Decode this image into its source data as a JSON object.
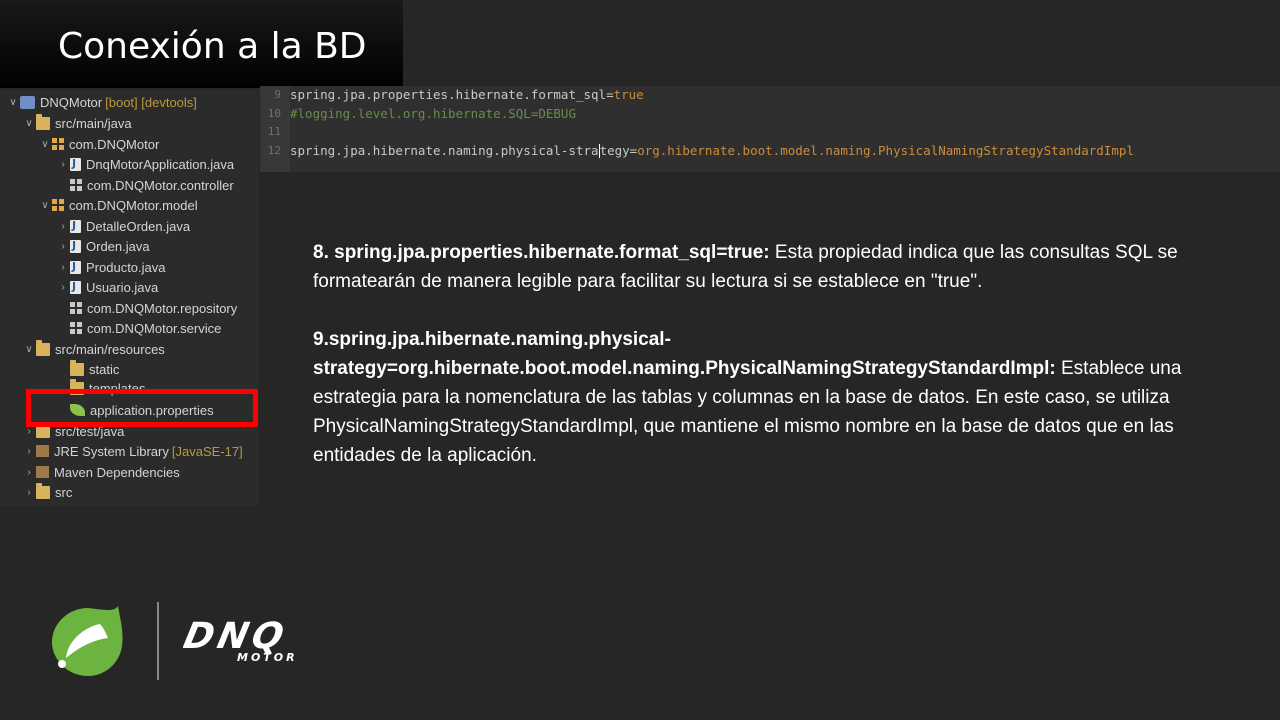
{
  "slide": {
    "title": "Conexión a la BD"
  },
  "explorer": {
    "rows": [
      {
        "twisty": "v",
        "icon": "proj",
        "label": "DNQMotor",
        "extra": "[boot] [devtools]"
      },
      {
        "twisty": "v",
        "icon": "folder",
        "label": "src/main/java"
      },
      {
        "twisty": "v",
        "icon": "pkg",
        "label": "com.DNQMotor"
      },
      {
        "twisty": ">",
        "icon": "java",
        "label": "DnqMotorApplication.java"
      },
      {
        "twisty": "",
        "icon": "pkg-empty",
        "label": "com.DNQMotor.controller"
      },
      {
        "twisty": "v",
        "icon": "pkg",
        "label": "com.DNQMotor.model"
      },
      {
        "twisty": ">",
        "icon": "java",
        "label": "DetalleOrden.java"
      },
      {
        "twisty": ">",
        "icon": "java",
        "label": "Orden.java"
      },
      {
        "twisty": ">",
        "icon": "java",
        "label": "Producto.java"
      },
      {
        "twisty": ">",
        "icon": "java",
        "label": "Usuario.java"
      },
      {
        "twisty": "",
        "icon": "pkg-empty",
        "label": "com.DNQMotor.repository"
      },
      {
        "twisty": "",
        "icon": "pkg-empty",
        "label": "com.DNQMotor.service"
      },
      {
        "twisty": "v",
        "icon": "folder",
        "label": "src/main/resources"
      },
      {
        "twisty": "",
        "icon": "folder",
        "label": "static"
      },
      {
        "twisty": "",
        "icon": "folder",
        "label": "templates"
      },
      {
        "twisty": "",
        "icon": "leaf",
        "label": "application.properties"
      },
      {
        "twisty": ">",
        "icon": "folder",
        "label": "src/test/java"
      },
      {
        "twisty": ">",
        "icon": "jar",
        "label": "JRE System Library",
        "extra": "[JavaSE-17]"
      },
      {
        "twisty": ">",
        "icon": "jar",
        "label": "Maven Dependencies"
      },
      {
        "twisty": ">",
        "icon": "folder",
        "label": "src"
      }
    ]
  },
  "editor": {
    "lines": [
      {
        "num": "9",
        "key": "spring.jpa.properties.hibernate.format_sql=",
        "value": "true"
      },
      {
        "num": "10",
        "comment": "#logging.level.org.hibernate.SQL=DEBUG"
      },
      {
        "num": "11"
      },
      {
        "num": "12",
        "key_before_caret": "spring.jpa.hibernate.naming.physical-stra",
        "key_after_caret": "tegy=",
        "value": "org.hibernate.boot.model.naming.PhysicalNamingStrategyStandardImpl"
      }
    ]
  },
  "description": {
    "item8_label": "8. spring.jpa.properties.hibernate.format_sql=true:",
    "item8_text": " Esta propiedad indica que las consultas SQL se formatearán de manera legible para facilitar su lectura si se establece en \"true\".",
    "item9_label": "9.spring.jpa.hibernate.naming.physical-strategy=org.hibernate.boot.model.naming.PhysicalNamingStrategyStandardImpl:",
    "item9_text": " Establece una estrategia para la nomenclatura de las tablas y columnas en la base de datos. En este caso, se utiliza PhysicalNamingStrategyStandardImpl, que mantiene el mismo nombre en la base de datos que en las entidades de la aplicación."
  },
  "logos": {
    "dnq_text": "DNQ",
    "dnq_sub": "MOTOR"
  }
}
